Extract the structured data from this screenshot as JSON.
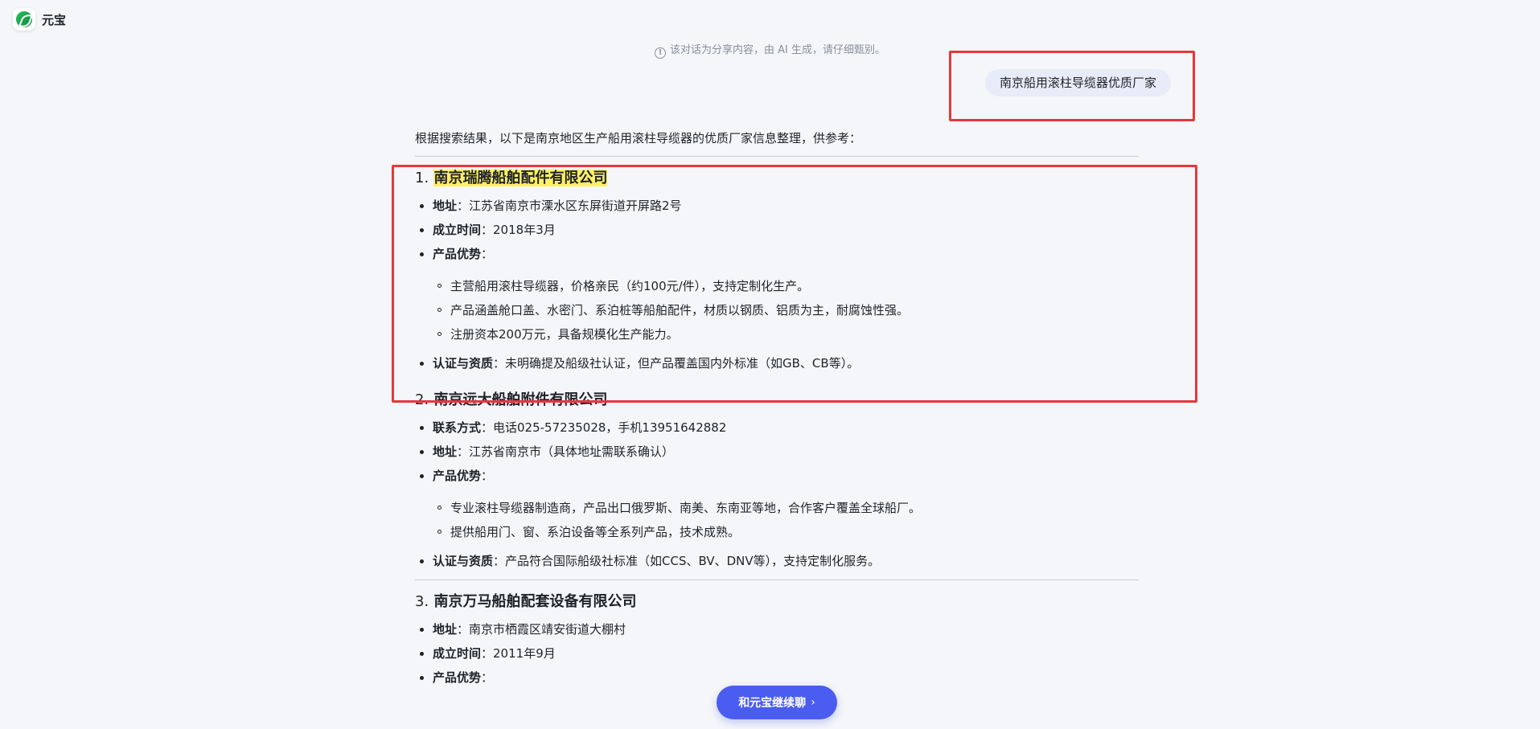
{
  "app": {
    "title": "元宝"
  },
  "notice": "该对话为分享内容，由 AI 生成，请仔细甄别。",
  "user_message": "南京船用滚柱导缆器优质厂家",
  "intro": "根据搜索结果，以下是南京地区生产船用滚柱导缆器的优质厂家信息整理，供参考：",
  "sections": [
    {
      "num": "1.",
      "name": "南京瑞腾船舶配件有限公司",
      "items": [
        {
          "k": "地址",
          "v": "：江苏省南京市溧水区东屏街道开屏路2号"
        },
        {
          "k": "成立时间",
          "v": "：2018年3月"
        },
        {
          "k": "产品优势",
          "v": "：",
          "sub": [
            "主营船用滚柱导缆器，价格亲民（约100元/件），支持定制化生产。",
            "产品涵盖舱口盖、水密门、系泊桩等船舶配件，材质以钢质、铝质为主，耐腐蚀性强。",
            "注册资本200万元，具备规模化生产能力。"
          ]
        },
        {
          "k": "认证与资质",
          "v": "：未明确提及船级社认证，但产品覆盖国内外标准（如GB、CB等）。"
        }
      ]
    },
    {
      "num": "2.",
      "name": "南京远大船舶附件有限公司",
      "items": [
        {
          "k": "联系方式",
          "v": "：电话025-57235028，手机13951642882"
        },
        {
          "k": "地址",
          "v": "：江苏省南京市（具体地址需联系确认）"
        },
        {
          "k": "产品优势",
          "v": "：",
          "sub": [
            "专业滚柱导缆器制造商，产品出口俄罗斯、南美、东南亚等地，合作客户覆盖全球船厂。",
            "提供船用门、窗、系泊设备等全系列产品，技术成熟。"
          ]
        },
        {
          "k": "认证与资质",
          "v": "：产品符合国际船级社标准（如CCS、BV、DNV等），支持定制化服务。"
        }
      ]
    },
    {
      "num": "3.",
      "name": "南京万马船舶配套设备有限公司",
      "items": [
        {
          "k": "地址",
          "v": "：南京市栖霞区靖安街道大棚村"
        },
        {
          "k": "成立时间",
          "v": "：2011年9月"
        },
        {
          "k": "产品优势",
          "v": "："
        }
      ]
    }
  ],
  "cta": {
    "label": "和元宝继续聊",
    "icon": "chevron-right-icon"
  },
  "colors": {
    "accent": "#4a5df0",
    "highlight": "#fff066",
    "annotation": "#e5383b"
  }
}
